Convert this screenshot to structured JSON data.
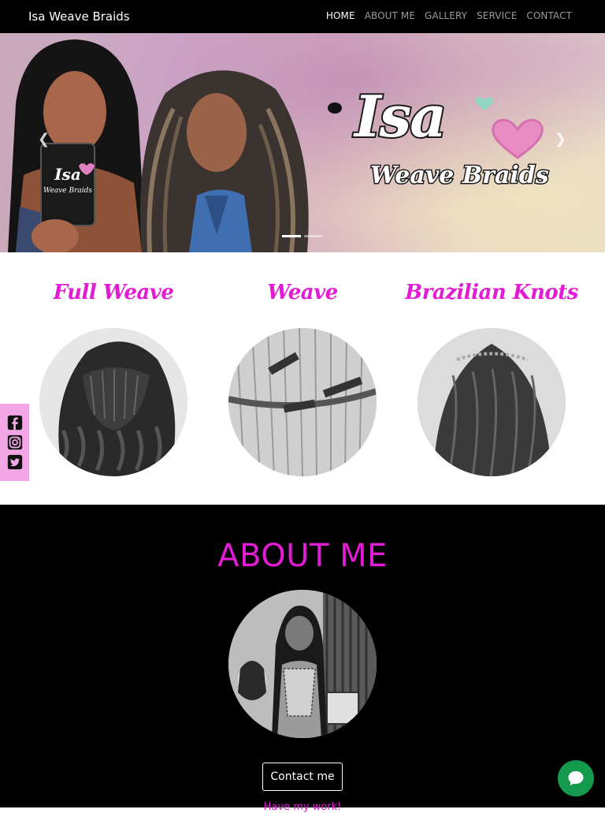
{
  "navbar": {
    "brand": "Isa Weave Braids",
    "links": [
      {
        "label": "HOME",
        "active": true
      },
      {
        "label": "ABOUT ME",
        "active": false
      },
      {
        "label": "GALLERY",
        "active": false
      },
      {
        "label": "SERVICE",
        "active": false
      },
      {
        "label": "CONTACT",
        "active": false
      }
    ]
  },
  "hero": {
    "logo_title": "Isa",
    "logo_subtitle": "Weave Braids",
    "prev_icon": "chevron-left-icon",
    "next_icon": "chevron-right-icon",
    "slide_count": 2,
    "active_slide": 1
  },
  "services": [
    {
      "title": "Full Weave"
    },
    {
      "title": "Weave"
    },
    {
      "title": "Brazilian Knots"
    }
  ],
  "social": {
    "icons": [
      "facebook-icon",
      "instagram-icon",
      "twitter-icon"
    ],
    "bg_color": "#f3a6e6"
  },
  "about": {
    "title": "ABOUT ME",
    "contact_button": "Contact me",
    "work_link": "Have my work!"
  },
  "chat": {
    "icon": "chat-bubble-icon",
    "color": "#139a4c"
  },
  "colors": {
    "accent": "#e21bd4",
    "nav_bg": "#000000"
  }
}
